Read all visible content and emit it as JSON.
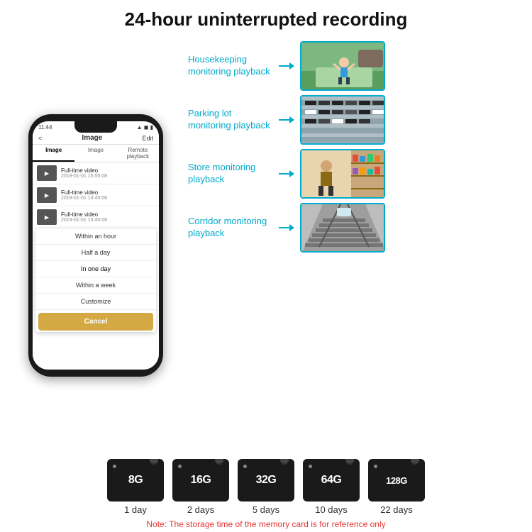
{
  "title": "24-hour uninterrupted recording",
  "phone": {
    "time": "11:44",
    "nav_back": "<",
    "nav_title": "Image",
    "nav_edit": "Edit",
    "tabs": [
      "Image",
      "Image",
      "Remote playback"
    ],
    "videos": [
      {
        "title": "Full-time video",
        "date": "2019-01-01 15:55:08"
      },
      {
        "title": "Full-time video",
        "date": "2019-01-01 13:45:08"
      },
      {
        "title": "Full-time video",
        "date": "2019-01-01 13:40:08"
      }
    ],
    "dropdown_items": [
      "Within an hour",
      "Half a day",
      "In one day",
      "Within a week",
      "Customize"
    ],
    "cancel_label": "Cancel"
  },
  "monitoring": [
    {
      "label": "Housekeeping\nmonitoring playback",
      "icon": "🧒"
    },
    {
      "label": "Parking lot\nmonitoring playback",
      "icon": "🚗"
    },
    {
      "label": "Store monitoring\nplayback",
      "icon": "🛍️"
    },
    {
      "label": "Corridor monitoring\nplayback",
      "icon": "🏢"
    }
  ],
  "storage": {
    "cards": [
      {
        "size": "8G",
        "days": "1 day"
      },
      {
        "size": "16G",
        "days": "2 days"
      },
      {
        "size": "32G",
        "days": "5 days"
      },
      {
        "size": "64G",
        "days": "10 days"
      },
      {
        "size": "128G",
        "days": "22 days"
      }
    ],
    "note": "Note: The storage time of the memory card is for reference only"
  }
}
